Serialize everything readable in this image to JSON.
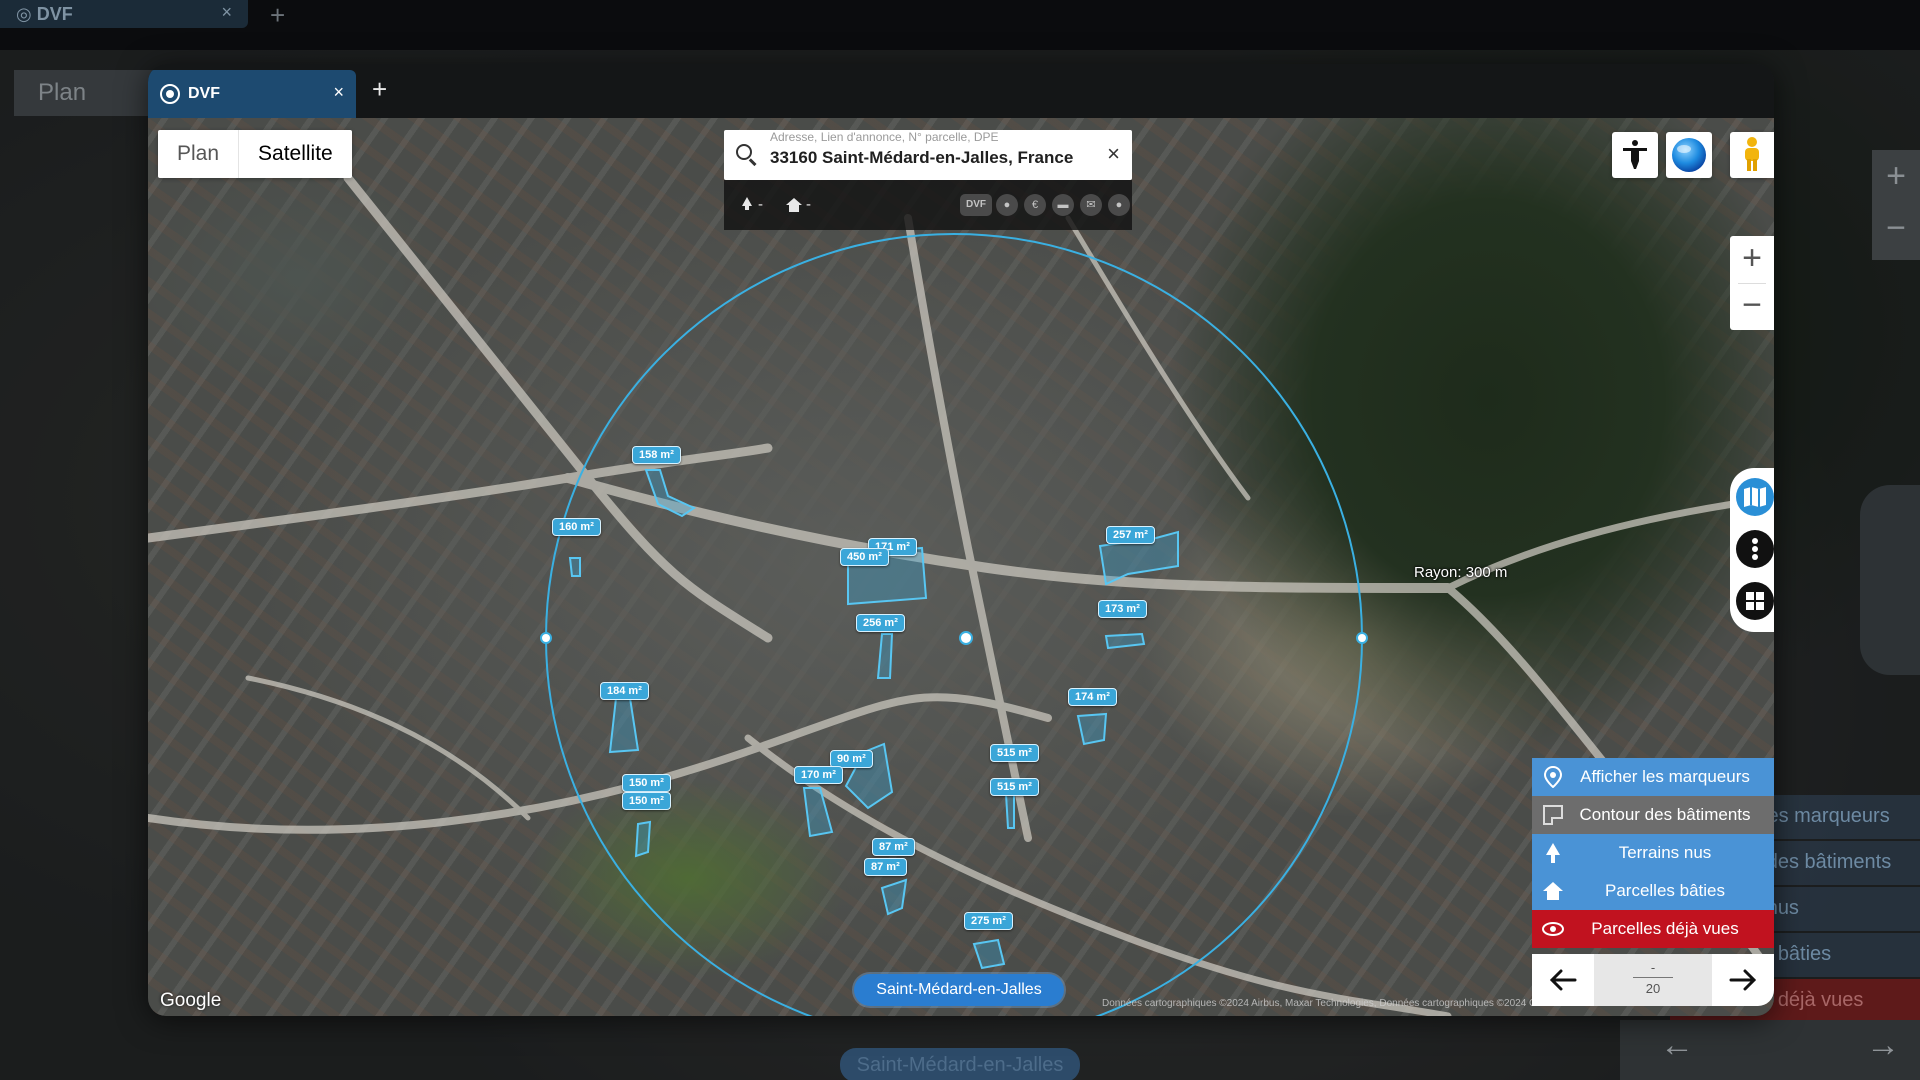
{
  "app": {
    "tab_title": "DVF",
    "tab_close": "×",
    "new_tab": "+"
  },
  "map_type": {
    "plan": "Plan",
    "satellite": "Satellite",
    "selected": "Satellite"
  },
  "search": {
    "hint": "Adresse, Lien d'annonce, N° parcelle, DPE",
    "value": "33160 Saint-Médard-en-Jalles, France",
    "clear": "×"
  },
  "filters": {
    "terrain_value": "-",
    "bati_value": "-",
    "dvf_label": "DVF",
    "icons": [
      "pin-icon",
      "euro-icon",
      "chat-icon",
      "mail-icon",
      "user-icon"
    ]
  },
  "controls": {
    "zoom_in": "+",
    "zoom_out": "−",
    "top_right_icons": [
      "accessibility-icon",
      "globe-icon",
      "pegman-icon"
    ],
    "rail_icons": [
      "map-icon",
      "more-vertical-icon",
      "grid-icon"
    ]
  },
  "radius_label": "Rayon: 300 m",
  "parcels": [
    {
      "label": "158 m²"
    },
    {
      "label": "160 m²"
    },
    {
      "label": "171 m²"
    },
    {
      "label": "450 m²"
    },
    {
      "label": "257 m²"
    },
    {
      "label": "256 m²"
    },
    {
      "label": "173 m²"
    },
    {
      "label": "184 m²"
    },
    {
      "label": "174 m²"
    },
    {
      "label": "515 m²"
    },
    {
      "label": "90 m²"
    },
    {
      "label": "170 m²"
    },
    {
      "label": "515 m²"
    },
    {
      "label": "150 m²"
    },
    {
      "label": "150 m²"
    },
    {
      "label": "87 m²"
    },
    {
      "label": "87 m²"
    },
    {
      "label": "275 m²"
    }
  ],
  "menu": [
    {
      "label": "Afficher les marqueurs",
      "color": "#4a93d6"
    },
    {
      "label": "Contour des bâtiments",
      "color": "#707070"
    },
    {
      "label": "Terrains nus",
      "color": "#4a93d6"
    },
    {
      "label": "Parcelles bâties",
      "color": "#4a93d6"
    },
    {
      "label": "Parcelles déjà vues",
      "color": "#c1121f"
    }
  ],
  "pagination": {
    "current": "-",
    "total": "20"
  },
  "locality_chip": "Saint-Médard-en-Jalles",
  "attribution": "Google",
  "copyright": "Données cartographiques ©2024 Airbus, Maxar Technologies, Données cartographiques ©2024 Google"
}
